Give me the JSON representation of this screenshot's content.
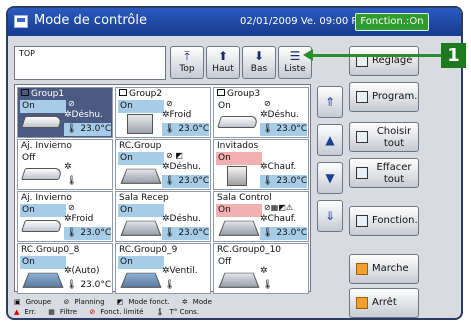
{
  "window": {
    "title": "Mode de contrôle",
    "datetime": "02/01/2009 Ve. 09:00 PM",
    "function_badge": "Fonction.:On"
  },
  "path": {
    "text": "TOP"
  },
  "nav": [
    {
      "label": "Top",
      "icon": "up-arrow-bar-icon"
    },
    {
      "label": "Haut",
      "icon": "up-arrow-icon"
    },
    {
      "label": "Bas",
      "icon": "down-arrow-icon"
    },
    {
      "label": "Liste",
      "icon": "list-icon"
    }
  ],
  "groups": [
    {
      "name": "Group1",
      "status": "On",
      "mode": "Déshu.",
      "temp": "23.0°C"
    },
    {
      "name": "Group2",
      "status": "On",
      "mode": "Froid",
      "temp": "23.0°C"
    },
    {
      "name": "Group3",
      "status": "On",
      "mode": "Déshu.",
      "temp": "23.0°C"
    },
    {
      "name": "Aj. Invierno",
      "status": "Off",
      "mode": "",
      "temp": ""
    },
    {
      "name": "RC.Group",
      "status": "On",
      "mode": "Déshu.",
      "temp": "23.0°C"
    },
    {
      "name": "Invitados",
      "status": "On",
      "mode": "Chauf.",
      "temp": "23.0°C"
    },
    {
      "name": "Aj. Invierno",
      "status": "On",
      "mode": "Froid",
      "temp": "23.0°C"
    },
    {
      "name": "Sala Recep",
      "status": "On",
      "mode": "Déshu.",
      "temp": "23.0°C"
    },
    {
      "name": "Sala Control",
      "status": "On",
      "mode": "Chauf.",
      "temp": "23.0°C"
    },
    {
      "name": "RC.Group0_8",
      "status": "On",
      "mode": "(Auto)",
      "temp": "23.0°C"
    },
    {
      "name": "RC.Group0_9",
      "status": "On",
      "mode": "Ventil.",
      "temp": ""
    },
    {
      "name": "RC.Group0_10",
      "status": "Off",
      "mode": "",
      "temp": ""
    }
  ],
  "scroll": [
    {
      "icon": "double-up-icon",
      "glyph": "⇑"
    },
    {
      "icon": "up-icon",
      "glyph": "▲"
    },
    {
      "icon": "down-icon",
      "glyph": "▼"
    },
    {
      "icon": "double-down-icon",
      "glyph": "⇓"
    }
  ],
  "right_buttons": {
    "reglage": "Réglage",
    "program": "Program.",
    "choisir_1": "Choisir",
    "choisir_2": "tout",
    "effacer_1": "Effacer",
    "effacer_2": "tout",
    "fonction": "Fonction.",
    "marche": "Marche",
    "arret": "Arrêt"
  },
  "legend": {
    "groupe": "Groupe",
    "planning": "Planning",
    "mode_fonct": "Mode fonct.",
    "mode": "Mode",
    "err": "Err.",
    "filtre": "Filtre",
    "fonct_limite": "Fonct. limité",
    "t_cons": "T° Cons."
  },
  "callout": {
    "label": "1"
  },
  "colors": {
    "title_bar": "#1f4aa8",
    "on_blue": "#a7cce8",
    "heat_red": "#f3b0b0",
    "fonction_green": "#2f9b2f",
    "callout_green": "#1e7a1e"
  }
}
